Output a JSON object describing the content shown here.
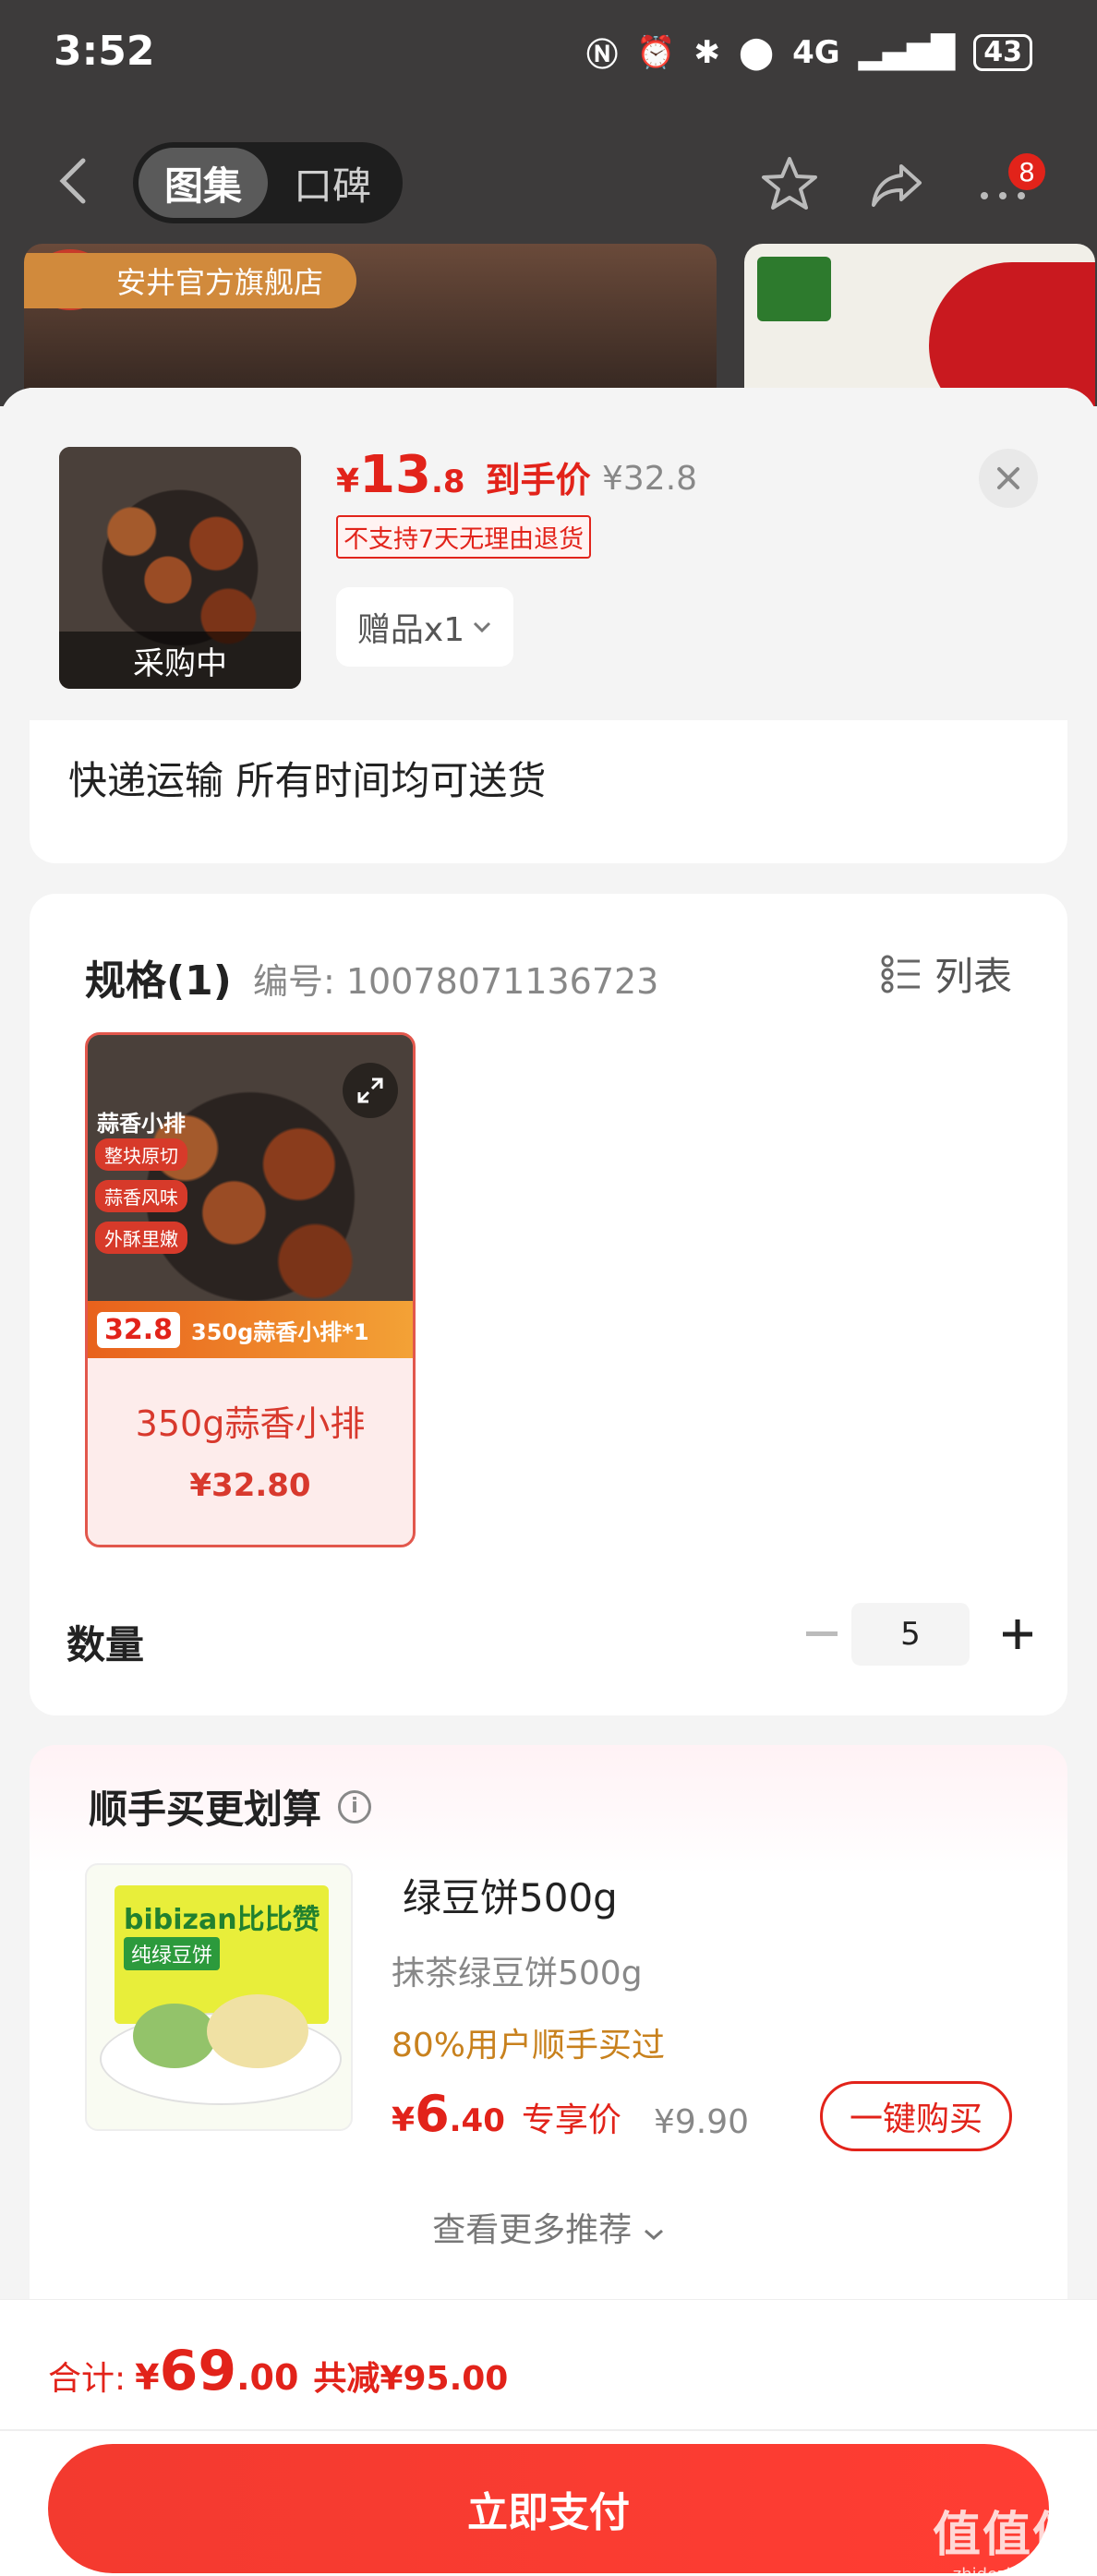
{
  "status_bar": {
    "time": "3:52",
    "network": "4G",
    "battery": "43"
  },
  "nav": {
    "tabs": [
      {
        "label": "图集",
        "active": true
      },
      {
        "label": "口碑",
        "active": false
      }
    ],
    "badge": "8",
    "icons": [
      "back-icon",
      "star-icon",
      "share-icon",
      "more-icon"
    ]
  },
  "background": {
    "store_tag": "安井官方旗舰店"
  },
  "sheet": {
    "thumb_overlay": "采购中",
    "price": {
      "currency": "¥",
      "int": "13",
      "dec": ".8",
      "label": "到手价"
    },
    "original_price": "¥32.8",
    "no_return": "不支持7天无理由退货",
    "gift": "赠品x1"
  },
  "delivery": {
    "text": "快递运输 所有时间均可送货"
  },
  "spec": {
    "title": "规格(1)",
    "code": "编号: 10078071136723",
    "list_label": "列表",
    "item": {
      "name_tag": "蒜香小排",
      "tags": [
        "整块原切",
        "蒜香风味",
        "外酥里嫩"
      ],
      "promo_price": "32.8",
      "promo_text": "350g蒜香小排*1",
      "name": "350g蒜香小排",
      "price": "¥32.80"
    },
    "qty_label": "数量",
    "qty_value": "5"
  },
  "recommend": {
    "title": "顺手买更划算",
    "product": {
      "brand": "bibizan比比赞",
      "box_sub": "纯绿豆饼",
      "name": "绿豆饼500g",
      "sub": "抹茶绿豆饼500g",
      "bought": "80%用户顺手买过",
      "price": {
        "currency": "¥",
        "int": "6",
        "dec": ".40",
        "label": "专享价"
      },
      "original_price": "¥9.90",
      "buy_label": "一键购买"
    },
    "more_label": "查看更多推荐"
  },
  "bottom": {
    "total_label": "合计:",
    "total": {
      "currency": "¥",
      "int": "69",
      "dec": ".00"
    },
    "saved": "共减¥95.00",
    "pay_label": "立即支付",
    "watermark": "值值值",
    "watermark_sub": "zhidezhi.com"
  },
  "colors": {
    "accent": "#e2231a",
    "gold": "#c8811d",
    "muted": "#888888"
  }
}
